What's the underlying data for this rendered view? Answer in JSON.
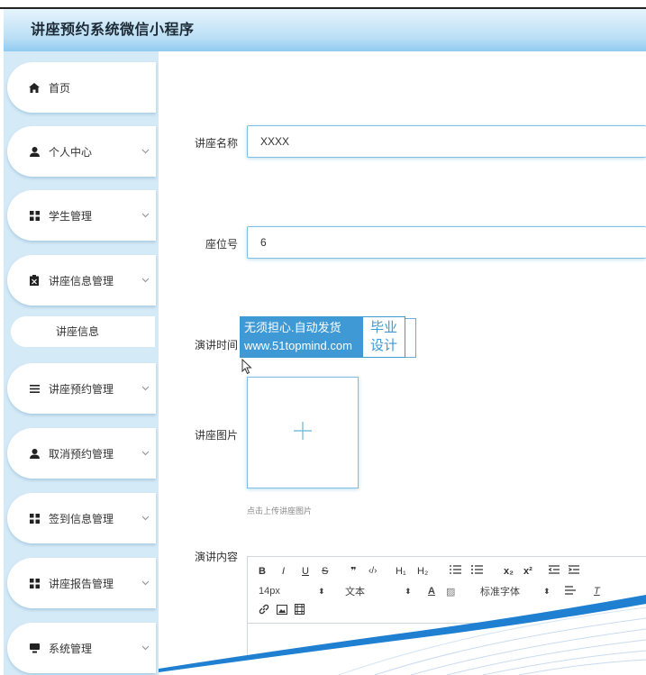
{
  "app": {
    "title": "讲座预约系统微信小程序"
  },
  "sidebar": {
    "items": [
      {
        "label": "首页",
        "icon": "home-icon",
        "has_chevron": false
      },
      {
        "label": "个人中心",
        "icon": "user-icon",
        "has_chevron": true
      },
      {
        "label": "学生管理",
        "icon": "grid-icon",
        "has_chevron": true
      },
      {
        "label": "讲座信息管理",
        "icon": "clipboard-icon",
        "has_chevron": true
      },
      {
        "label": "讲座预约管理",
        "icon": "list-icon",
        "has_chevron": true
      },
      {
        "label": "取消预约管理",
        "icon": "user-icon",
        "has_chevron": true
      },
      {
        "label": "签到信息管理",
        "icon": "grid-icon",
        "has_chevron": true
      },
      {
        "label": "讲座报告管理",
        "icon": "grid-icon",
        "has_chevron": true
      },
      {
        "label": "系统管理",
        "icon": "monitor-icon",
        "has_chevron": true
      }
    ],
    "sub_item": "讲座信息"
  },
  "form": {
    "name_label": "讲座名称",
    "name_value": "XXXX",
    "seat_label": "座位号",
    "seat_value": "6",
    "time_label": "演讲时间",
    "image_label": "讲座图片",
    "upload_hint": "点击上传讲座图片",
    "content_label": "演讲内容"
  },
  "watermark": {
    "line1": "无须担心.自动发货",
    "line2": "www.51topmind.com",
    "right1": "毕业",
    "right2": "设计"
  },
  "editor": {
    "toolbar1": [
      "B",
      "I",
      "U",
      "S",
      "❞",
      "‹/›",
      "H₁",
      "H₂",
      "list-ordered-icon",
      "list-bullet-icon",
      "x₂",
      "x²",
      "indent-left-icon",
      "indent-right-icon"
    ],
    "size": "14px",
    "text_type": "文本",
    "font": "标准字体",
    "colors": {
      "accent": "#3e99d4",
      "border": "#7fbfe0",
      "sidebar": "#d5eaf7"
    }
  }
}
